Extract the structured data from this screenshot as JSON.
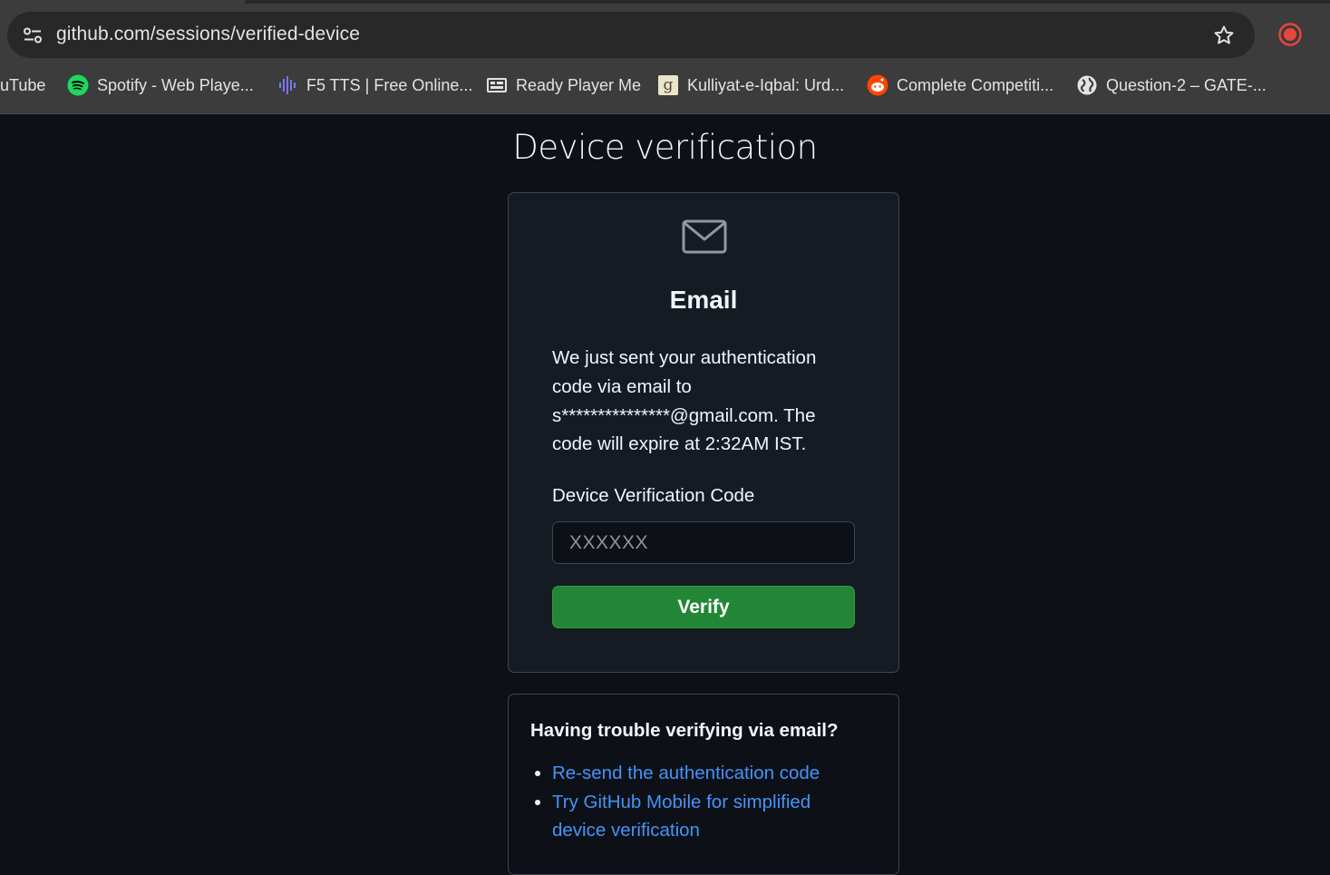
{
  "browser": {
    "url": "github.com/sessions/verified-device",
    "icons": {
      "site_info": "tune-icon",
      "bookmark_star": "star-icon",
      "record": "record-icon"
    },
    "bookmarks": [
      {
        "label": "uTube",
        "icon": "none"
      },
      {
        "label": "Spotify - Web Playe...",
        "icon": "spotify-icon"
      },
      {
        "label": "F5 TTS | Free Online...",
        "icon": "audio-wave-icon"
      },
      {
        "label": "Ready Player Me",
        "icon": "ready-player-me-icon"
      },
      {
        "label": "Kulliyat-e-Iqbal: Urd...",
        "icon": "goodreads-icon"
      },
      {
        "label": "Complete Competiti...",
        "icon": "reddit-icon"
      },
      {
        "label": "Question-2 – GATE-...",
        "icon": "globe-icon"
      }
    ]
  },
  "page": {
    "title": "Device verification",
    "card": {
      "icon": "mail-icon",
      "heading": "Email",
      "message": "We just sent your authentication code via email to s***************@gmail.com. The code will expire at 2:32AM IST.",
      "code_label": "Device Verification Code",
      "code_placeholder": "XXXXXX",
      "code_value": "",
      "verify_label": "Verify"
    },
    "help": {
      "title": "Having trouble verifying via email?",
      "links": [
        "Re-send the authentication code",
        "Try GitHub Mobile for simplified device verification"
      ]
    }
  },
  "colors": {
    "background": "#0d1117",
    "card": "#151b23",
    "border": "#3d444d",
    "verify_button": "#238636",
    "link": "#4493f8",
    "record": "#e8453c"
  }
}
